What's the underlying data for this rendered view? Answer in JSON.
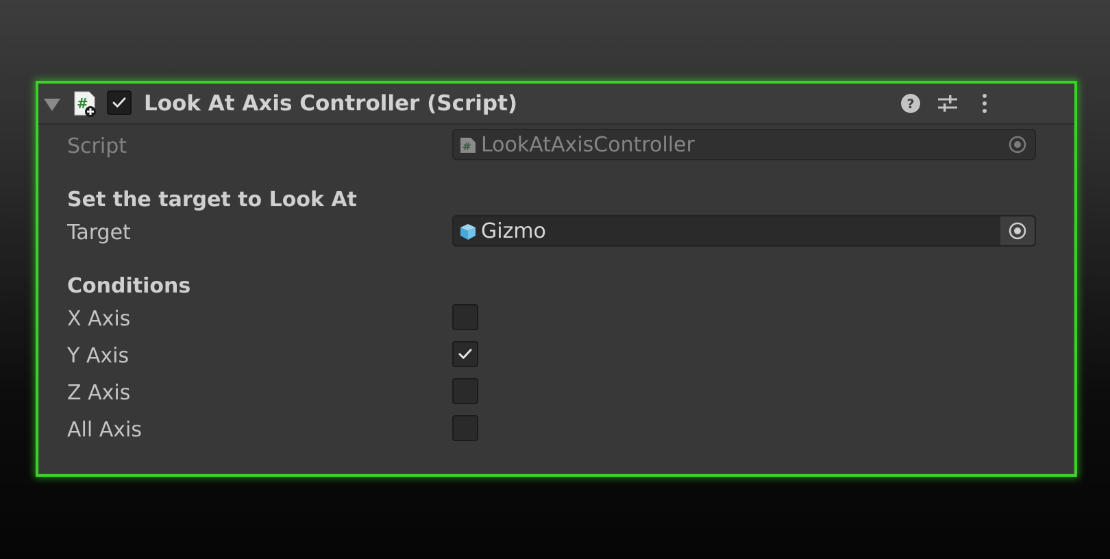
{
  "component": {
    "title": "Look At Axis Controller (Script)",
    "enabled": true,
    "accent_color": "#3ecf2c",
    "header_icons": [
      "help-icon",
      "preset-sliders-icon",
      "more-vert-icon"
    ]
  },
  "fields": {
    "script": {
      "label": "Script",
      "value": "LookAtAxisController",
      "icon": "cs-script-icon"
    },
    "section_target": "Set the target to Look At",
    "target": {
      "label": "Target",
      "value": "Gizmo",
      "icon": "prefab-cube-icon"
    },
    "section_conditions": "Conditions",
    "x_axis": {
      "label": "X Axis",
      "checked": false
    },
    "y_axis": {
      "label": "Y Axis",
      "checked": true
    },
    "z_axis": {
      "label": "Z Axis",
      "checked": false
    },
    "all_axis": {
      "label": "All Axis",
      "checked": false
    }
  }
}
